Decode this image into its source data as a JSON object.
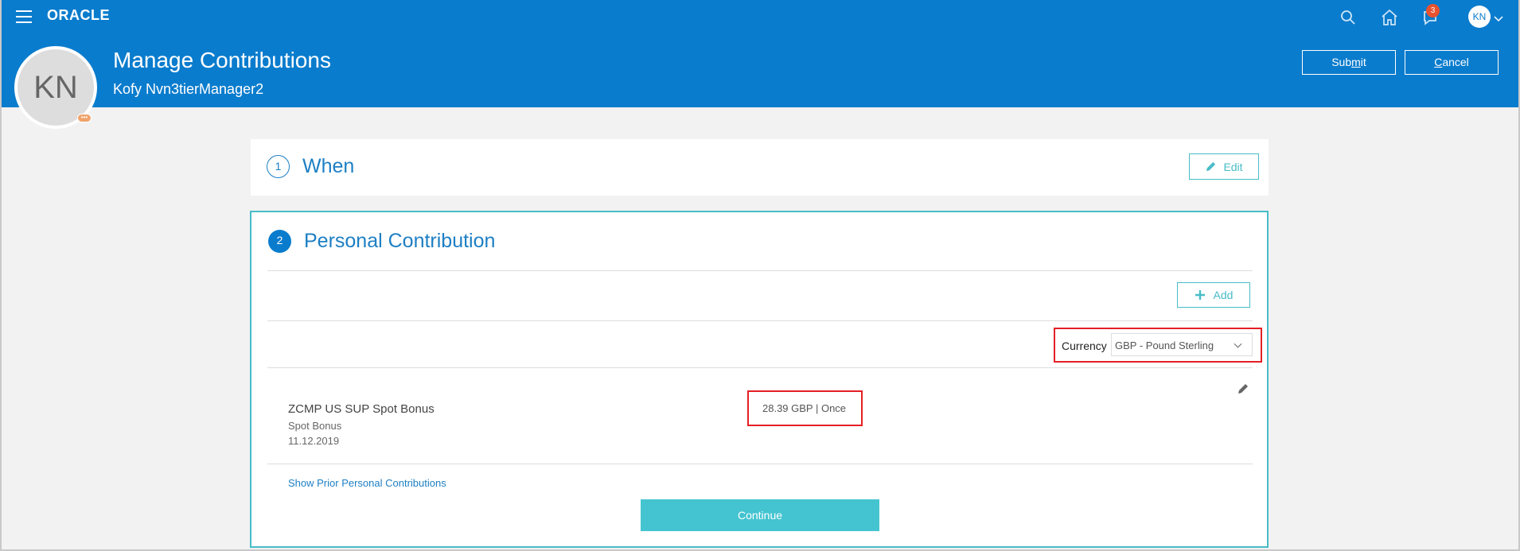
{
  "app": {
    "logo": "ORACLE",
    "notification_count": "3",
    "user_initials": "KN"
  },
  "header": {
    "avatar_initials": "KN",
    "title": "Manage Contributions",
    "subtitle": "Kofy Nvn3tierManager2",
    "submit_pre": "Sub",
    "submit_mnemonic": "m",
    "submit_post": "it",
    "cancel_mnemonic": "C",
    "cancel_post": "ancel"
  },
  "when_section": {
    "step": "1",
    "title": "When",
    "edit_label": "Edit"
  },
  "contribution_section": {
    "step": "2",
    "title": "Personal Contribution",
    "add_label": "Add",
    "currency_label": "Currency",
    "currency_value": "GBP - Pound Sterling",
    "item": {
      "name": "ZCMP US SUP Spot Bonus",
      "type": "Spot Bonus",
      "date": "11.12.2019",
      "amount": "28.39 GBP | Once"
    },
    "show_prior_link": "Show Prior Personal Contributions",
    "continue_label": "Continue"
  },
  "colors": {
    "brand_blue": "#0a7ccd",
    "accent_teal": "#44c4d0",
    "highlight_red": "#e41f26"
  }
}
